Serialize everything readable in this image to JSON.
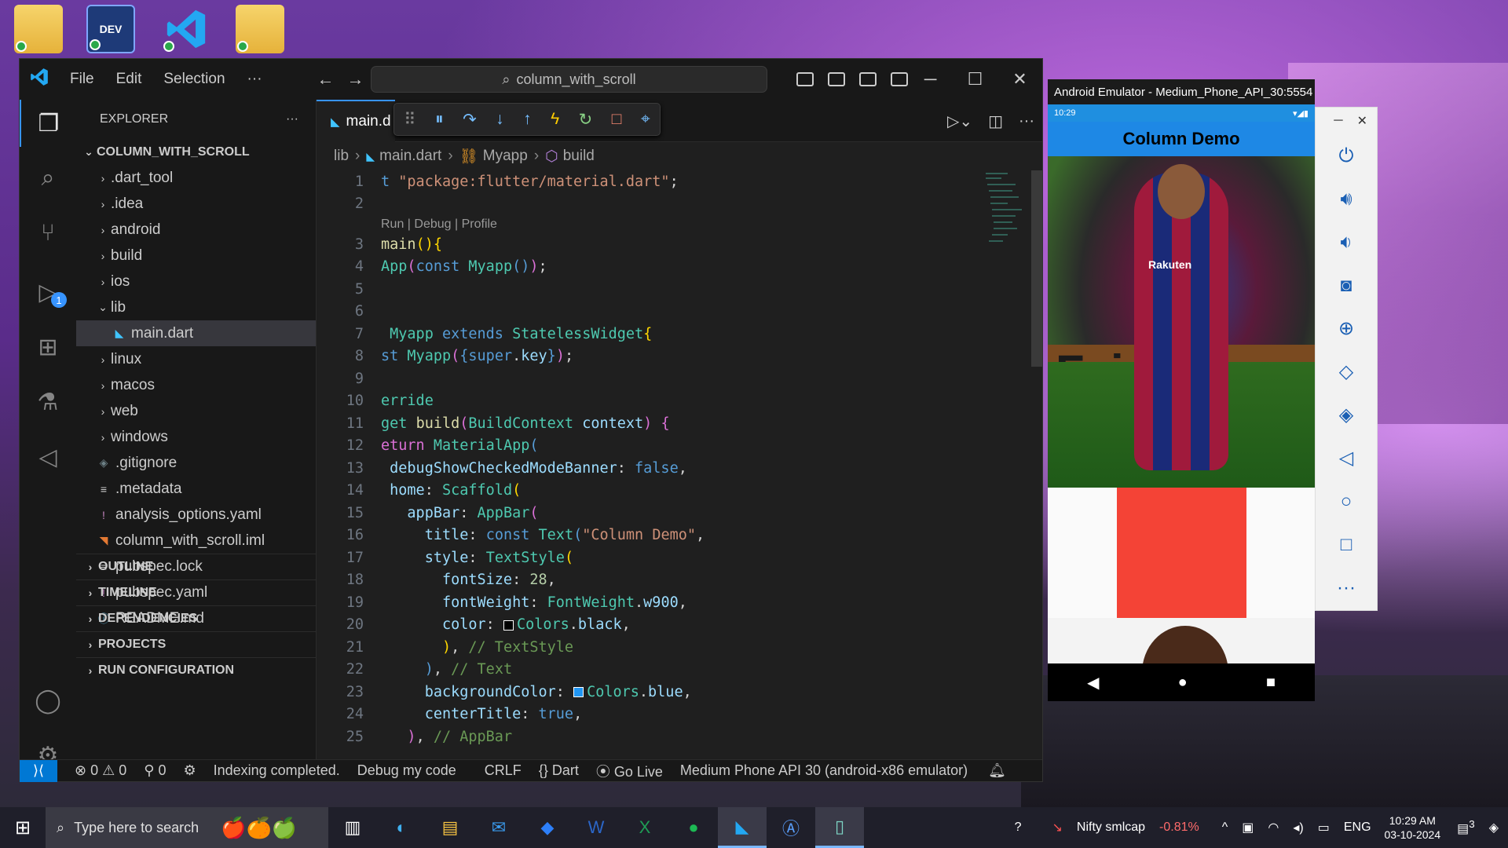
{
  "vscode": {
    "menu": [
      "File",
      "Edit",
      "Selection",
      "···"
    ],
    "command_center": "column_with_scroll",
    "explorer": {
      "title": "EXPLORER",
      "root": "COLUMN_WITH_SCROLL",
      "items": [
        {
          "label": ".dart_tool",
          "type": "folder",
          "indent": 1
        },
        {
          "label": ".idea",
          "type": "folder",
          "indent": 1
        },
        {
          "label": "android",
          "type": "folder",
          "indent": 1
        },
        {
          "label": "build",
          "type": "folder",
          "indent": 1
        },
        {
          "label": "ios",
          "type": "folder",
          "indent": 1
        },
        {
          "label": "lib",
          "type": "folder-open",
          "indent": 1
        },
        {
          "label": "main.dart",
          "type": "dart",
          "indent": 2,
          "selected": true
        },
        {
          "label": "linux",
          "type": "folder",
          "indent": 1
        },
        {
          "label": "macos",
          "type": "folder",
          "indent": 1
        },
        {
          "label": "web",
          "type": "folder",
          "indent": 1
        },
        {
          "label": "windows",
          "type": "folder",
          "indent": 1
        },
        {
          "label": ".gitignore",
          "type": "git",
          "indent": 1
        },
        {
          "label": ".metadata",
          "type": "text",
          "indent": 1
        },
        {
          "label": "analysis_options.yaml",
          "type": "yaml",
          "indent": 1
        },
        {
          "label": "column_with_scroll.iml",
          "type": "rss",
          "indent": 1
        },
        {
          "label": "pubspec.lock",
          "type": "text",
          "indent": 1
        },
        {
          "label": "pubspec.yaml",
          "type": "yaml",
          "indent": 1
        },
        {
          "label": "README.md",
          "type": "info",
          "indent": 1
        }
      ],
      "sections": [
        "OUTLINE",
        "TIMELINE",
        "DEPENDENCIES",
        "PROJECTS",
        "RUN CONFIGURATION"
      ]
    },
    "tab": "main.d",
    "breadcrumb": [
      "lib",
      "main.dart",
      "Myapp",
      "build"
    ],
    "codelens": "Run | Debug | Profile",
    "status": {
      "errors": "0",
      "warnings": "0",
      "ports": "0",
      "indexing": "Indexing completed.",
      "debug": "Debug my code",
      "eol": "CRLF",
      "language": "Dart",
      "golive": "Go Live",
      "device": "Medium Phone API 30 (android-x86 emulator)"
    },
    "run_badge": "1"
  },
  "code_lines": [
    {
      "n": "1",
      "html": "<span class=\"k\">t</span> <span class=\"s\">\"package:flutter/material.dart\"</span>;"
    },
    {
      "n": "2",
      "html": ""
    },
    {
      "n": "3",
      "html": "<span class=\"f\">main</span><span class=\"y\">()</span><span class=\"y\">{</span>"
    },
    {
      "n": "4",
      "html": "<span class=\"t\">App</span><span class=\"m\">(</span><span class=\"k\">const</span> <span class=\"t\">Myapp</span><span class=\"k\">()</span><span class=\"m\">)</span>;"
    },
    {
      "n": "5",
      "html": ""
    },
    {
      "n": "6",
      "html": ""
    },
    {
      "n": "7",
      "html": " <span class=\"t\">Myapp</span> <span class=\"k\">extends</span> <span class=\"t\">StatelessWidget</span><span class=\"y\">{</span>"
    },
    {
      "n": "8",
      "html": "<span class=\"k\">st</span> <span class=\"t\">Myapp</span><span class=\"m\">(</span><span class=\"k\">{</span><span class=\"k\">super</span>.<span class=\"p\">key</span><span class=\"k\">}</span><span class=\"m\">)</span>;"
    },
    {
      "n": "9",
      "html": ""
    },
    {
      "n": "10",
      "html": "<span class=\"t\">erride</span>"
    },
    {
      "n": "11",
      "html": "<span class=\"t\">get</span> <span class=\"f\">build</span><span class=\"m\">(</span><span class=\"t\">BuildContext</span> <span class=\"p\">context</span><span class=\"m\">)</span> <span class=\"m\">{</span>"
    },
    {
      "n": "12",
      "html": "<span class=\"m\">eturn</span> <span class=\"t\">MaterialApp</span><span class=\"k\">(</span>"
    },
    {
      "n": "13",
      "html": " <span class=\"p\">debugShowCheckedModeBanner</span>: <span class=\"k\">false</span>,"
    },
    {
      "n": "14",
      "html": " <span class=\"p\">home</span>: <span class=\"t\">Scaffold</span><span class=\"y\">(</span>"
    },
    {
      "n": "15",
      "html": "   <span class=\"p\">appBar</span>: <span class=\"t\">AppBar</span><span class=\"m\">(</span>"
    },
    {
      "n": "16",
      "html": "     <span class=\"p\">title</span>: <span class=\"k\">const</span> <span class=\"t\">Text</span><span class=\"k\">(</span><span class=\"s\">\"Column Demo\"</span>,"
    },
    {
      "n": "17",
      "html": "     <span class=\"p\">style</span>: <span class=\"t\">TextStyle</span><span class=\"y\">(</span>"
    },
    {
      "n": "18",
      "html": "       <span class=\"p\">fontSize</span>: <span class=\"n\">28</span>,"
    },
    {
      "n": "19",
      "html": "       <span class=\"p\">fontWeight</span>: <span class=\"t\">FontWeight</span>.<span class=\"p\">w900</span>,"
    },
    {
      "n": "20",
      "html": "       <span class=\"p\">color</span>: <span class=\"swatch\" style=\"background:#000\"></span><span class=\"t\">Colors</span>.<span class=\"p\">black</span>,"
    },
    {
      "n": "21",
      "html": "       <span class=\"y\">)</span>, <span class=\"c\">// TextStyle</span>"
    },
    {
      "n": "22",
      "html": "     <span class=\"k\">)</span>, <span class=\"c\">// Text</span>"
    },
    {
      "n": "23",
      "html": "     <span class=\"p\">backgroundColor</span>: <span class=\"swatch\" style=\"background:#2196f3\"></span><span class=\"t\">Colors</span>.<span class=\"p\">blue</span>,"
    },
    {
      "n": "24",
      "html": "     <span class=\"p\">centerTitle</span>: <span class=\"k\">true</span>,"
    },
    {
      "n": "25",
      "html": "   <span class=\"m\">)</span>, <span class=\"c\">// AppBar</span>"
    }
  ],
  "emulator": {
    "title": "Android Emulator - Medium_Phone_API_30:5554",
    "time": "10:29",
    "app_title": "Column Demo",
    "banner_text": "Fair",
    "jersey_text": "Rakuten"
  },
  "taskbar": {
    "search_placeholder": "Type here to search",
    "stock_name": "Nifty smlcap",
    "stock_change": "-0.81%",
    "language": "ENG",
    "time": "10:29 AM",
    "date": "03-10-2024",
    "notifications": "3"
  },
  "colors": {
    "accent": "#0078d4",
    "appbar": "#1e88e5",
    "red_box": "#f44336",
    "stock_down": "#ff6b6b"
  }
}
